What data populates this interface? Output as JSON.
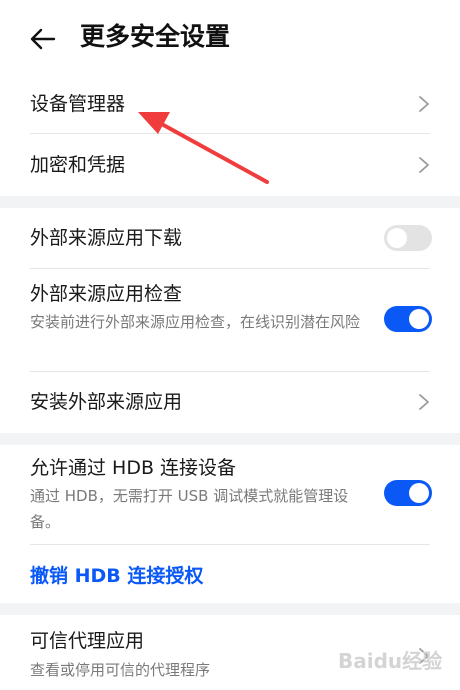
{
  "header": {
    "title": "更多安全设置"
  },
  "section1": {
    "items": [
      {
        "label": "设备管理器"
      },
      {
        "label": "加密和凭据"
      }
    ]
  },
  "section2": {
    "items": [
      {
        "label": "外部来源应用下载",
        "toggle": "off"
      },
      {
        "label": "外部来源应用检查",
        "desc": "安装前进行外部来源应用检查，在线识别潜在风险",
        "toggle": "on"
      },
      {
        "label": "安装外部来源应用"
      }
    ]
  },
  "section3": {
    "hdb_label": "允许通过 HDB 连接设备",
    "hdb_desc": "通过 HDB，无需打开 USB 调试模式就能管理设备。",
    "hdb_toggle": "on",
    "revoke_label": "撤销 HDB 连接授权"
  },
  "section4": {
    "trust_label": "可信代理应用",
    "trust_desc": "查看或停用可信的代理程序"
  },
  "colors": {
    "accent": "#0a59f7",
    "annotation_arrow": "#f03c3c",
    "background": "#f1f3f5"
  },
  "watermark": {
    "text": "Baidu经验"
  }
}
